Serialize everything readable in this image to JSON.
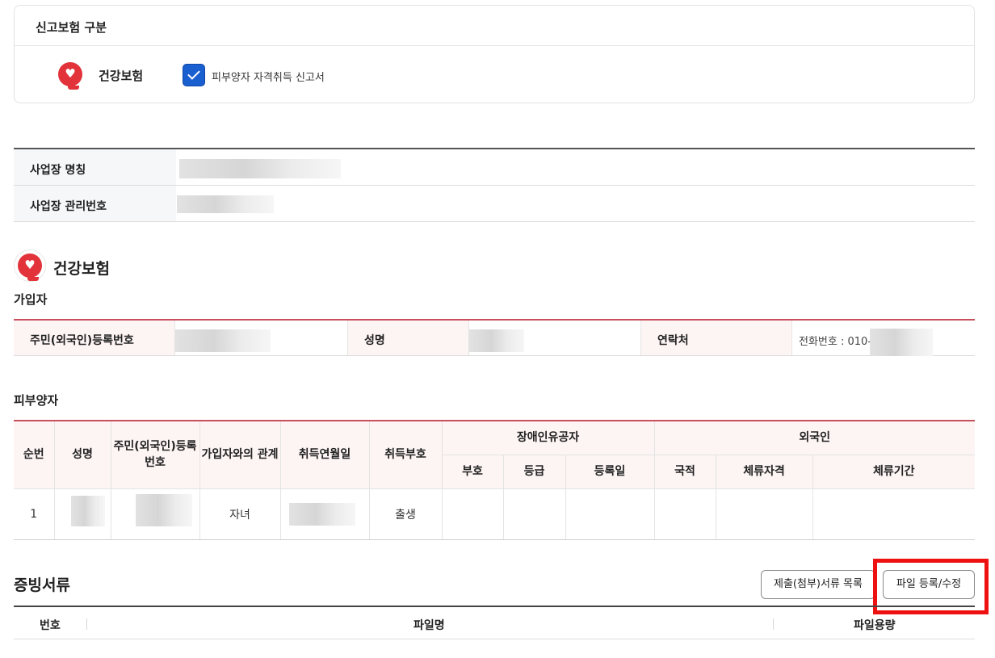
{
  "insurance_type": {
    "heading": "신고보험 구분",
    "name": "건강보험",
    "checkbox_label": "피부양자 자격취득 신고서",
    "checked": true,
    "brand_color": "#e2323a",
    "check_color": "#1a5fd0"
  },
  "workplace": {
    "name_label": "사업장 명칭",
    "number_label": "사업장 관리번호"
  },
  "section": {
    "title": "건강보험",
    "subscriber_heading": "가입자"
  },
  "subscriber": {
    "rrn_label": "주민(외국인)등록번호",
    "name_label": "성명",
    "contact_label": "연락처",
    "contact_value": "전화번호 : 010-"
  },
  "dependents": {
    "heading": "피부양자",
    "headers": {
      "seq": "순번",
      "name": "성명",
      "rrn": "주민(외국인)등록번호",
      "relation": "가입자와의 관계",
      "acq_date": "취득연월일",
      "acq_code": "취득부호",
      "disabled_group": "장애인유공자",
      "disabled_code": "부호",
      "disabled_grade": "등급",
      "disabled_reg_date": "등록일",
      "foreigner_group": "외국인",
      "nationality": "국적",
      "stay_status": "체류자격",
      "stay_period": "체류기간"
    },
    "rows": [
      {
        "seq": "1",
        "relation": "자녀",
        "acq_code": "출생"
      }
    ]
  },
  "documents": {
    "heading": "증빙서류",
    "list_button": "제출(첨부)서류 목록",
    "upload_button": "파일 등록/수정",
    "col_no": "번호",
    "col_filename": "파일명",
    "col_size": "파일용량",
    "highlight_color": "#ee1111"
  }
}
